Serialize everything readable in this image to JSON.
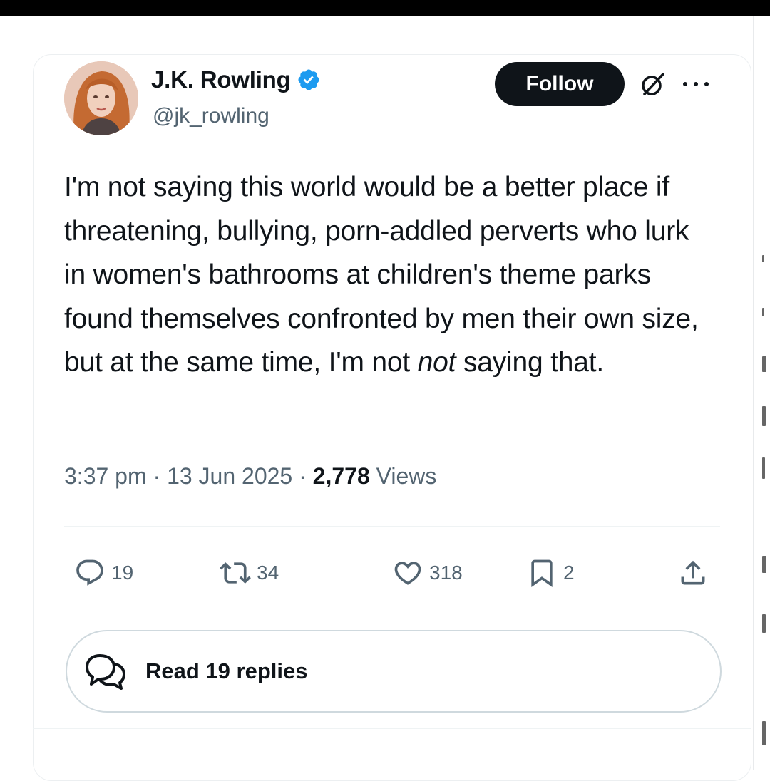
{
  "author": {
    "name": "J.K. Rowling",
    "handle": "@jk_rowling",
    "verified": true
  },
  "header": {
    "follow_label": "Follow"
  },
  "tweet": {
    "text_before_em": "I'm not saying this world would be a better place if threatening, bullying, porn-addled perverts who lurk in women's bathrooms at children's theme parks found themselves confronted by men their own size, but at the same time, I'm not ",
    "text_em": "not",
    "text_after_em": " saying that."
  },
  "meta": {
    "time": "3:37 pm",
    "separator_1": " · ",
    "date": "13 Jun 2025",
    "separator_2": " · ",
    "views_count": "2,778",
    "views_label": " Views"
  },
  "actions": {
    "replies": "19",
    "reposts": "34",
    "likes": "318",
    "bookmarks": "2"
  },
  "read_replies": {
    "label": "Read 19 replies"
  },
  "colors": {
    "accent_verified": "#1d9bf0",
    "text_primary": "#0f1419",
    "text_secondary": "#536471"
  },
  "icons": {
    "verified": "verified-badge-icon",
    "grok": "grok-icon",
    "more": "more-icon",
    "reply": "reply-icon",
    "repost": "repost-icon",
    "like": "heart-icon",
    "bookmark": "bookmark-icon",
    "share": "share-icon",
    "read_replies": "speech-bubbles-icon"
  }
}
